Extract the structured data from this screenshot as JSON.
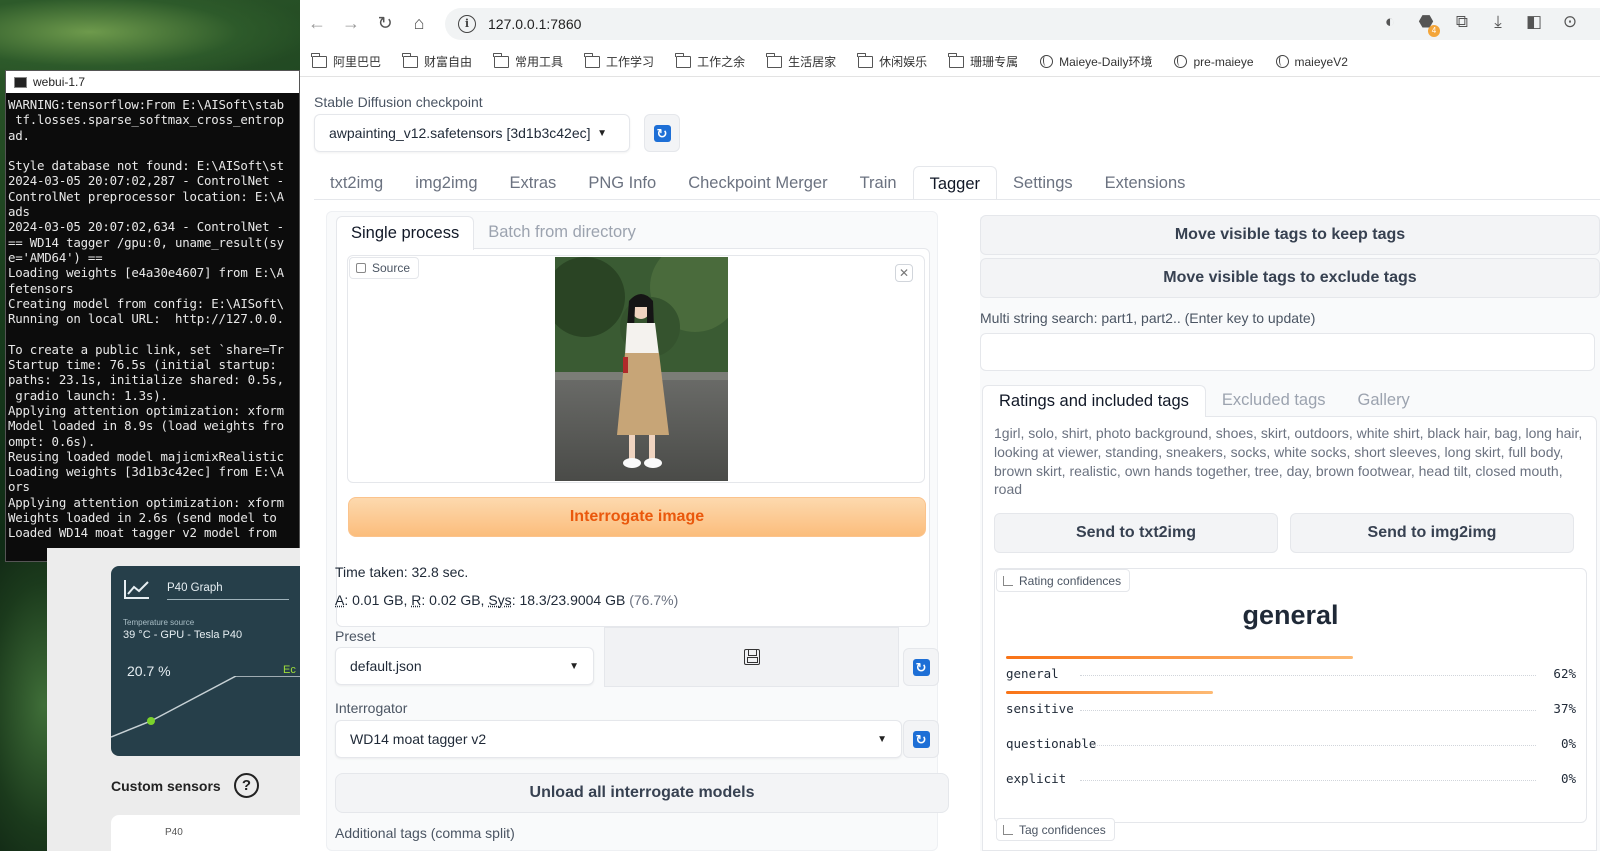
{
  "terminal": {
    "title": "webui-1.7",
    "lines": [
      "WARNING:tensorflow:From E:\\AISoft\\stab",
      " tf.losses.sparse_softmax_cross_entrop",
      "ad.",
      "",
      "Style database not found: E:\\AISoft\\st",
      "2024-03-05 20:07:02,287 - ControlNet -",
      "ControlNet preprocessor location: E:\\A",
      "ads",
      "2024-03-05 20:07:02,634 - ControlNet -",
      "== WD14 tagger /gpu:0, uname_result(sy",
      "e='AMD64') ==",
      "Loading weights [e4a30e4607] from E:\\A",
      "fetensors",
      "Creating model from config: E:\\AISoft\\",
      "Running on local URL:  http://127.0.0.",
      "",
      "To create a public link, set `share=Tr",
      "Startup time: 76.5s (initial startup:",
      "paths: 23.1s, initialize shared: 0.5s,",
      " gradio launch: 1.3s).",
      "Applying attention optimization: xform",
      "Model loaded in 8.9s (load weights fro",
      "ompt: 0.6s).",
      "Reusing loaded model majicmixRealistic",
      "Loading weights [3d1b3c42ec] from E:\\A",
      "ors",
      "Applying attention optimization: xform",
      "Weights loaded in 2.6s (send model to",
      "Loaded WD14 moat tagger v2 model from"
    ]
  },
  "sensor_widget": {
    "title": "P40 Graph",
    "source_label": "Temperature source",
    "source_value": "39 °C - GPU - Tesla P40",
    "percent": "20.7 %",
    "edge_text": "Ec",
    "custom_sensors": "Custom sensors",
    "help": "?",
    "card2_text": "P40"
  },
  "browser": {
    "url": "127.0.0.1:7860",
    "bookmarks": [
      {
        "label": "阿里巴巴",
        "icon": "folder-icon"
      },
      {
        "label": "财富自由",
        "icon": "folder-icon"
      },
      {
        "label": "常用工具",
        "icon": "folder-icon"
      },
      {
        "label": "工作学习",
        "icon": "folder-icon"
      },
      {
        "label": "工作之余",
        "icon": "folder-icon"
      },
      {
        "label": "生活居家",
        "icon": "folder-icon"
      },
      {
        "label": "休闲娱乐",
        "icon": "folder-icon"
      },
      {
        "label": "珊珊专属",
        "icon": "folder-icon"
      },
      {
        "label": "Maieye-Daily环境",
        "icon": "globe-icon"
      },
      {
        "label": "pre-maieye",
        "icon": "globe-icon"
      },
      {
        "label": "maieyeV2",
        "icon": "globe-icon"
      }
    ],
    "extension_badge": "4"
  },
  "webui": {
    "checkpoint_label": "Stable Diffusion checkpoint",
    "checkpoint_value": "awpainting_v12.safetensors [3d1b3c42ec]",
    "tabs": [
      "txt2img",
      "img2img",
      "Extras",
      "PNG Info",
      "Checkpoint Merger",
      "Train",
      "Tagger",
      "Settings",
      "Extensions"
    ],
    "active_tab": "Tagger",
    "sub_tabs": [
      "Single process",
      "Batch from directory"
    ],
    "source_label": "Source",
    "interrogate_button": "Interrogate image",
    "time_taken": "Time taken: 32.8 sec.",
    "mem": {
      "a_label": "A",
      "a_value": ": 0.01 GB, ",
      "r_label": "R",
      "r_value": ": 0.02 GB, ",
      "sys_label": "Sys",
      "sys_value": ": 18.3/23.9004 GB ",
      "pct": "(76.7%)"
    },
    "preset_label": "Preset",
    "preset_value": "default.json",
    "interrogator_label": "Interrogator",
    "interrogator_value": "WD14 moat tagger v2",
    "unload_button": "Unload all interrogate models",
    "additional_tags_label": "Additional tags (comma split)",
    "move_keep_button": "Move visible tags to keep tags",
    "move_exclude_button": "Move visible tags to exclude tags",
    "multi_search_label": "Multi string search: part1, part2.. (Enter key to update)",
    "multi_search_value": "",
    "tags_tabs": [
      "Ratings and included tags",
      "Excluded tags",
      "Gallery"
    ],
    "tags_text": "1girl, solo, shirt, photo background, shoes, skirt, outdoors, white shirt, black hair, bag, long hair, looking at viewer, standing, sneakers, socks, white socks, short sleeves, long skirt, full body, brown skirt, realistic, own hands together, tree, day, brown footwear, head tilt, closed mouth, road",
    "send_txt2img": "Send to txt2img",
    "send_img2img": "Send to img2img",
    "rating_confidences_label": "Rating confidences",
    "rating_top": "general",
    "ratings": [
      {
        "name": "general",
        "value": "62%",
        "fraction": 0.62
      },
      {
        "name": "sensitive",
        "value": "37%",
        "fraction": 0.37
      },
      {
        "name": "questionable",
        "value": "0%",
        "fraction": 0.0
      },
      {
        "name": "explicit",
        "value": "0%",
        "fraction": 0.0
      }
    ],
    "tag_confidences_label": "Tag confidences"
  }
}
